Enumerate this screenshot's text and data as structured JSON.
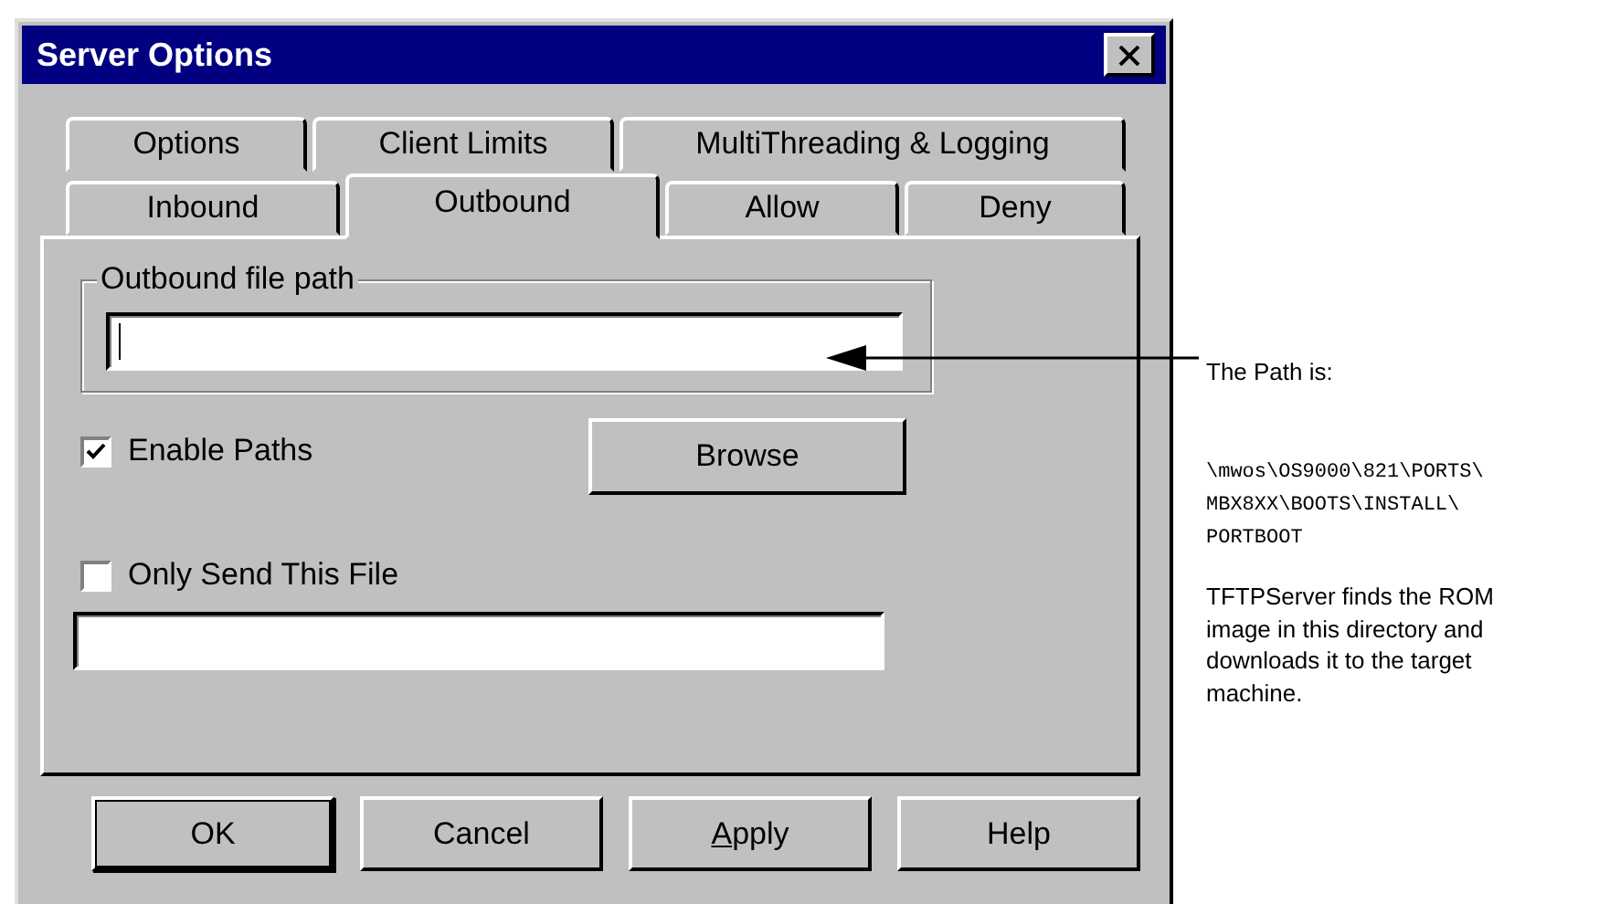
{
  "window": {
    "title": "Server Options"
  },
  "tab_rows": [
    [
      {
        "label": "Options",
        "selected": false
      },
      {
        "label": "Client Limits",
        "selected": false
      },
      {
        "label": "MultiThreading & Logging",
        "selected": false
      }
    ],
    [
      {
        "label": "Inbound",
        "selected": false
      },
      {
        "label": "Outbound",
        "selected": true
      },
      {
        "label": "Allow",
        "selected": false
      },
      {
        "label": "Deny",
        "selected": false
      }
    ]
  ],
  "group": {
    "legend": "Outbound file path"
  },
  "enable_paths": {
    "label": "Enable Paths",
    "checked": true
  },
  "browse_button": {
    "label": "Browse"
  },
  "only_send": {
    "label": "Only Send This File",
    "checked": false
  },
  "buttons": [
    {
      "label": "OK",
      "default": true,
      "underline_first": false
    },
    {
      "label": "Cancel",
      "default": false,
      "underline_first": false
    },
    {
      "label": "Apply",
      "default": false,
      "underline_first": true
    },
    {
      "label": "Help",
      "default": false,
      "underline_first": false
    }
  ],
  "annotation": {
    "heading": "The Path is:",
    "path_lines": [
      "\\mwos\\OS9000\\821\\PORTS\\",
      "MBX8XX\\BOOTS\\INSTALL\\",
      "PORTBOOT"
    ],
    "note": "TFTPServer finds the ROM image in this directory and downloads it to the target machine."
  }
}
